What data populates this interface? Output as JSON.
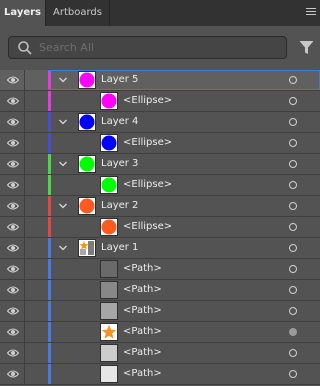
{
  "tabs": [
    {
      "label": "Layers",
      "active": true
    },
    {
      "label": "Artboards",
      "active": false
    }
  ],
  "search": {
    "placeholder": "Search All"
  },
  "accent": "#3f7ec7",
  "rows": [
    {
      "kind": "layer",
      "name": "Layer 5",
      "color": "#e040e0",
      "thumb": {
        "type": "circle",
        "fill": "#ff00ff"
      },
      "expanded": true,
      "selected": true,
      "target_filled": false
    },
    {
      "kind": "sub",
      "name": "<Ellipse>",
      "color": "#e040e0",
      "thumb": {
        "type": "circle",
        "fill": "#ff00ff"
      },
      "target_filled": false
    },
    {
      "kind": "layer",
      "name": "Layer 4",
      "color": "#4a4adc",
      "thumb": {
        "type": "circle",
        "fill": "#0000ff"
      },
      "expanded": true,
      "target_filled": false
    },
    {
      "kind": "sub",
      "name": "<Ellipse>",
      "color": "#4a4adc",
      "thumb": {
        "type": "circle",
        "fill": "#0000ff"
      },
      "target_filled": false
    },
    {
      "kind": "layer",
      "name": "Layer 3",
      "color": "#4ad84a",
      "thumb": {
        "type": "circle",
        "fill": "#00ff00"
      },
      "expanded": true,
      "target_filled": false
    },
    {
      "kind": "sub",
      "name": "<Ellipse>",
      "color": "#4ad84a",
      "thumb": {
        "type": "circle",
        "fill": "#00ff00"
      },
      "target_filled": false
    },
    {
      "kind": "layer",
      "name": "Layer 2",
      "color": "#e04848",
      "thumb": {
        "type": "circle",
        "fill": "#ff5a1f"
      },
      "expanded": true,
      "target_filled": false
    },
    {
      "kind": "sub",
      "name": "<Ellipse>",
      "color": "#e04848",
      "thumb": {
        "type": "circle",
        "fill": "#ff5a1f"
      },
      "target_filled": false
    },
    {
      "kind": "layer",
      "name": "Layer 1",
      "color": "#4a7ae0",
      "thumb": {
        "type": "mixed"
      },
      "expanded": true,
      "target_filled": false
    },
    {
      "kind": "sub",
      "name": "<Path>",
      "color": "#4a7ae0",
      "thumb": {
        "type": "square",
        "fill": "#6a6a6a"
      },
      "target_filled": false
    },
    {
      "kind": "sub",
      "name": "<Path>",
      "color": "#4a7ae0",
      "thumb": {
        "type": "square",
        "fill": "#888888"
      },
      "target_filled": false
    },
    {
      "kind": "sub",
      "name": "<Path>",
      "color": "#4a7ae0",
      "thumb": {
        "type": "square",
        "fill": "#a6a6a6"
      },
      "target_filled": false
    },
    {
      "kind": "sub",
      "name": "<Path>",
      "color": "#4a7ae0",
      "thumb": {
        "type": "star",
        "fill": "#f7941d"
      },
      "target_filled": true
    },
    {
      "kind": "sub",
      "name": "<Path>",
      "color": "#4a7ae0",
      "thumb": {
        "type": "square",
        "fill": "#cccccc"
      },
      "target_filled": false
    },
    {
      "kind": "sub",
      "name": "<Path>",
      "color": "#4a7ae0",
      "thumb": {
        "type": "square",
        "fill": "#e6e6e6"
      },
      "target_filled": false
    }
  ]
}
